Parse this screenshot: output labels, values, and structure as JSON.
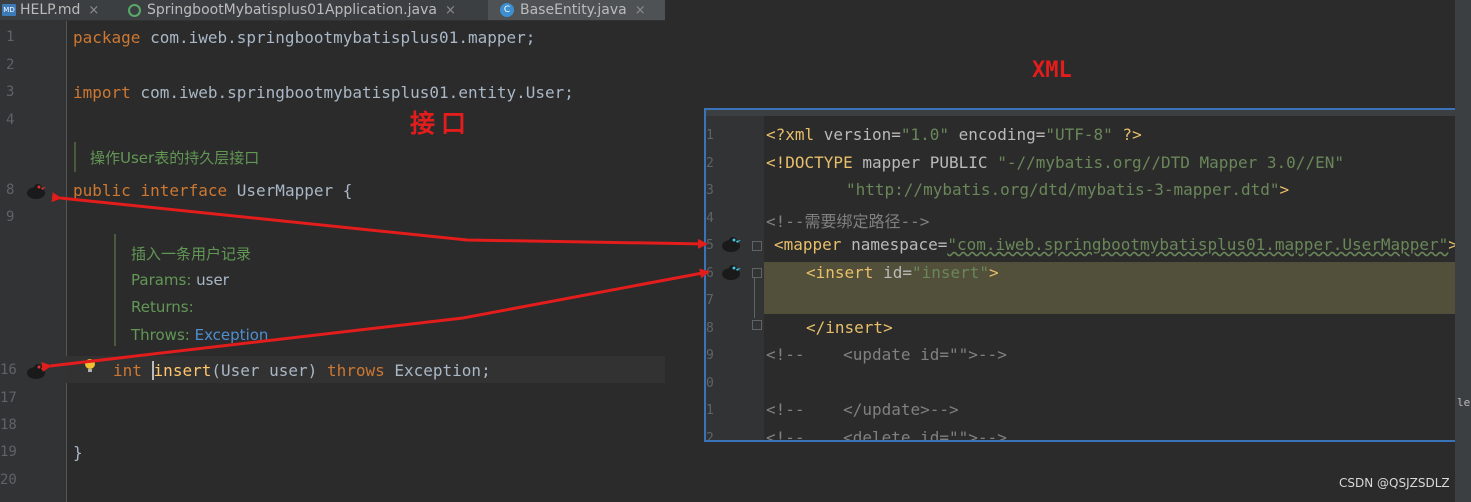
{
  "tabs": [
    {
      "label": "HELP.md",
      "icon": "markdown-file-icon",
      "icon_text": "MD"
    },
    {
      "label": "SpringbootMybatisplus01Application.java",
      "icon": "spring-boot-icon"
    },
    {
      "label": "BaseEntity.java",
      "icon": "java-class-icon",
      "icon_text": "C"
    }
  ],
  "tab_close": "×",
  "left_code": {
    "line_numbers": [
      "1",
      "2",
      "3",
      "4",
      "8",
      "9",
      "16",
      "17",
      "18",
      "19",
      "20"
    ],
    "package_kw": "package",
    "package_name": " com.iweb.springbootmybatisplus01.mapper;",
    "import_kw": "import",
    "import_name": " com.iweb.springbootmybatisplus01.entity.User;",
    "interface_doc": "操作User表的持久层接口",
    "public_kw": "public",
    "interface_kw": "interface",
    "interface_name": " UserMapper {",
    "method_doc": {
      "summary": "插入一条用户记录",
      "params_label": "Params:",
      "params_value": " user",
      "returns_label": "Returns:",
      "throws_label": "Throws:",
      "throws_value": " Exception"
    },
    "int_kw": "int",
    "method_name": "insert",
    "method_params": "(User user) ",
    "throws_kw": "throws",
    "throws_type": " Exception;",
    "closing_brace": "}"
  },
  "annotations": {
    "interface_label": "接口",
    "xml_label": "XML"
  },
  "xml_code": {
    "line_numbers": [
      "1",
      "2",
      "3",
      "4",
      "5",
      "6",
      "7",
      "8",
      "9",
      "0",
      "1",
      "2"
    ],
    "decl_open": "<?xml ",
    "decl_version_attr": "version=",
    "decl_version_val": "\"1.0\"",
    "decl_encoding_attr": " encoding=",
    "decl_encoding_val": "\"UTF-8\"",
    "decl_close": " ?>",
    "doctype_open": "<!DOCTYPE ",
    "doctype_body": "mapper PUBLIC ",
    "doctype_public": "\"-//mybatis.org//DTD Mapper 3.0//EN\"",
    "doctype_system": "\"http://mybatis.org/dtd/mybatis-3-mapper.dtd\"",
    "doctype_close": ">",
    "comment_path": "<!--需要绑定路径-->",
    "mapper_open": "<mapper ",
    "mapper_ns_attr": "namespace=",
    "mapper_ns_val": "\"com.iweb.springbootmybatisplus01.mapper.UserMapper\"",
    "mapper_close": ">",
    "insert_open": "<insert ",
    "insert_id_attr": "id=",
    "insert_id_val": "\"insert\"",
    "insert_close": ">",
    "insert_end": "</insert>",
    "comment_update_open": "<!--    <update id=\"\">-->",
    "comment_update_close": "<!--    </update>-->",
    "comment_delete_open": "<!--    <delete id=\"\">-->"
  },
  "right_scroll_text": "le",
  "watermark": "CSDN @QSJZSDLZ",
  "colors": {
    "annotation_red": "#e31c1c",
    "keyword": "#cc7832",
    "doc_comment": "#629755",
    "xml_tag": "#e8bf6a",
    "xml_value": "#6a8759",
    "panel_border": "#3a73b8"
  }
}
